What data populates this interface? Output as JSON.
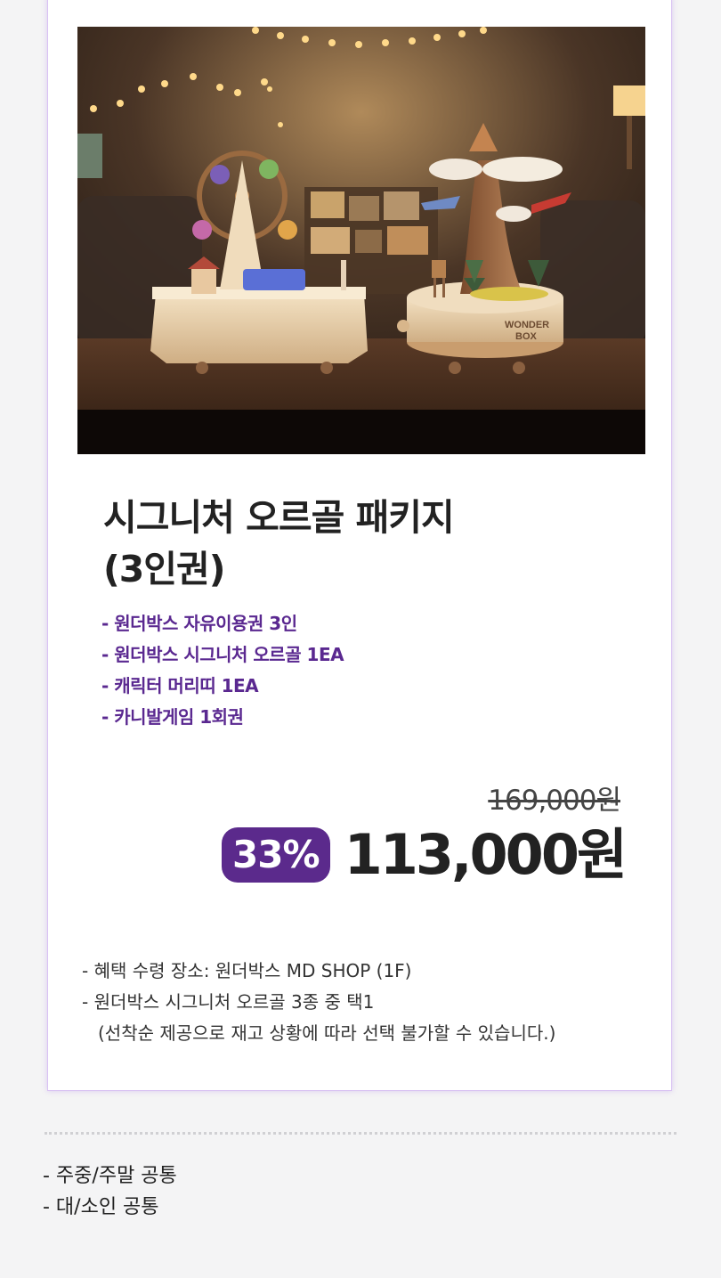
{
  "product": {
    "title_line1": "시그니처 오르골 패키지",
    "title_line2": "(3인권)",
    "benefits": [
      "- 원더박스 자유이용권 3인",
      "- 원더박스 시그니처 오르골 1EA",
      "- 캐릭터 머리띠 1EA",
      "- 카니발게임 1회권"
    ],
    "original_price": "169,000원",
    "discount": "33%",
    "sale_price": "113,000원",
    "box_label_1": "WONDER",
    "box_label_2": "BOX",
    "notes": [
      "- 혜택 수령 장소: 원더박스 MD SHOP (1F)",
      "- 원더박스 시그니처 오르골 3종 중 택1",
      "(선착순 제공으로 재고 상황에 따라 선택 불가할 수 있습니다.)"
    ]
  },
  "footer": [
    "- 주중/주말 공통",
    "- 대/소인 공통"
  ],
  "colors": {
    "accent": "#5b2a8c",
    "benefit_text": "#5a2890",
    "card_border": "#d9c2f3",
    "background": "#f4f4f5"
  }
}
